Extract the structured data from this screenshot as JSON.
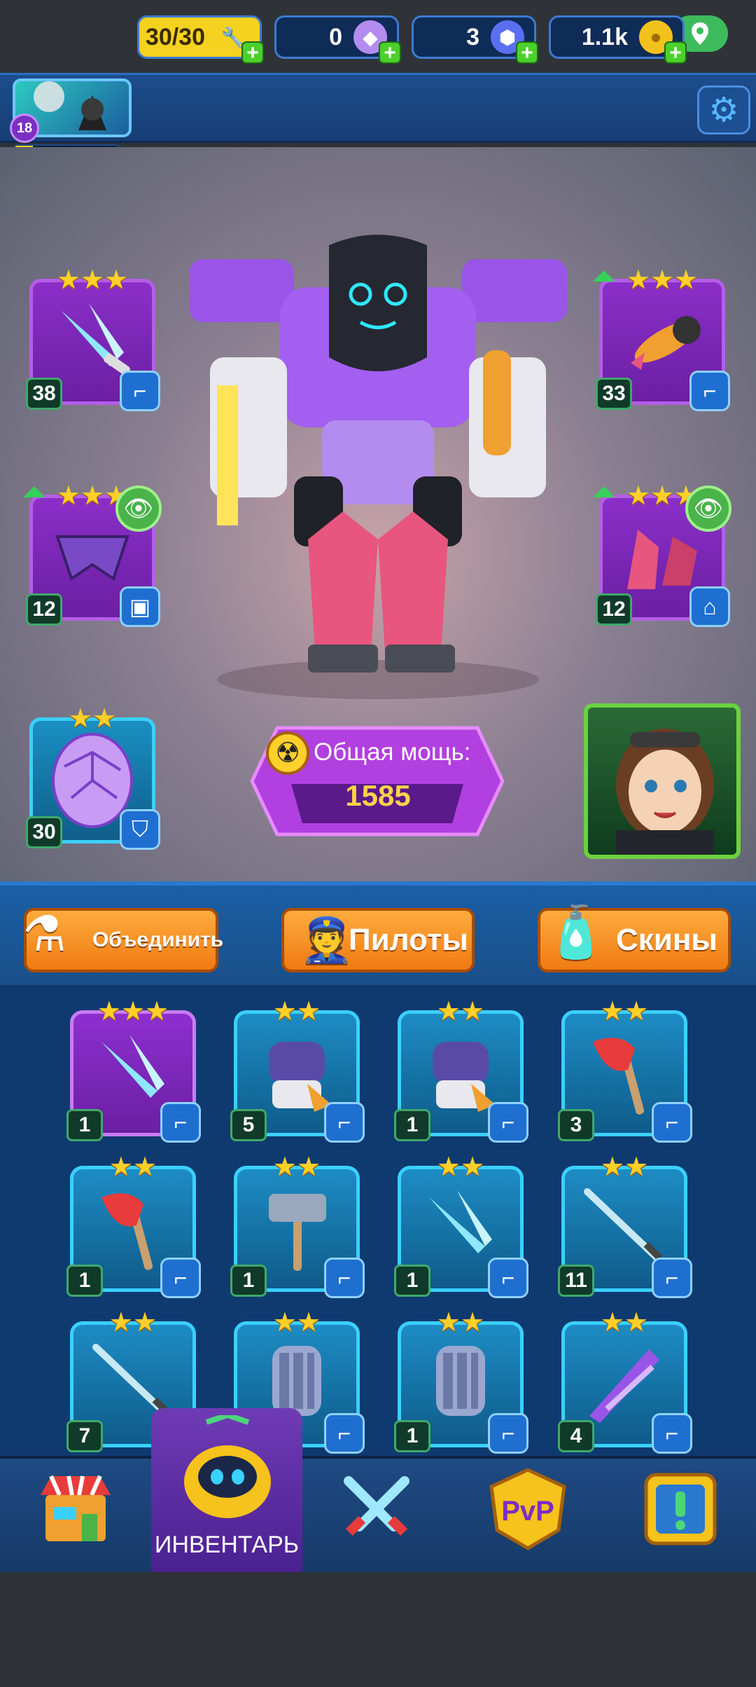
{
  "status": {
    "location_icon": "location-pin-icon"
  },
  "player": {
    "level": "18",
    "xp_progress": 0.17
  },
  "resources": {
    "energy": {
      "value": "30/30",
      "icon": "wrench-icon"
    },
    "gems": {
      "value": "0",
      "icon": "purple-gem-icon"
    },
    "crystals": {
      "value": "3",
      "icon": "crystal-icon"
    },
    "coins": {
      "value": "1.1k",
      "icon": "gold-coin-icon"
    }
  },
  "settings_icon": "gear-icon",
  "equipped": {
    "weapon_left": {
      "stars": "★★★",
      "level": "38",
      "type": "gun-icon"
    },
    "weapon_right": {
      "stars": "★★★",
      "level": "33",
      "type": "gun-icon"
    },
    "armor": {
      "stars": "★★★",
      "level": "12",
      "type": "armor-icon"
    },
    "boots": {
      "stars": "★★★",
      "level": "12",
      "type": "boot-icon"
    },
    "core": {
      "stars": "★★",
      "level": "30",
      "type": "shield-icon"
    }
  },
  "power": {
    "label": "Общая мощь:",
    "value": "1585"
  },
  "actions": {
    "merge": "Объединить",
    "pilots": "Пилоты",
    "skins": "Скины"
  },
  "inventory": [
    {
      "stars": "★★★",
      "level": "1",
      "item": "blade"
    },
    {
      "stars": "★★",
      "level": "5",
      "item": "gauntlet"
    },
    {
      "stars": "★★",
      "level": "1",
      "item": "gauntlet"
    },
    {
      "stars": "★★",
      "level": "3",
      "item": "axe"
    },
    {
      "stars": "★★",
      "level": "1",
      "item": "axe"
    },
    {
      "stars": "★★",
      "level": "1",
      "item": "hammer"
    },
    {
      "stars": "★★",
      "level": "1",
      "item": "blade"
    },
    {
      "stars": "★★",
      "level": "11",
      "item": "sword"
    },
    {
      "stars": "★★",
      "level": "7",
      "item": "sword"
    },
    {
      "stars": "★★",
      "level": "",
      "item": "gatling"
    },
    {
      "stars": "★★",
      "level": "1",
      "item": "gatling"
    },
    {
      "stars": "★★",
      "level": "4",
      "item": "launcher"
    }
  ],
  "nav": {
    "selected_label": "ИНВЕНТАРЬ"
  },
  "colors": {
    "accent_orange": "#ef7a12",
    "panel_blue": "#0f3a70",
    "rare_purple": "#8d2fd0",
    "common_blue": "#1d8cc4"
  }
}
